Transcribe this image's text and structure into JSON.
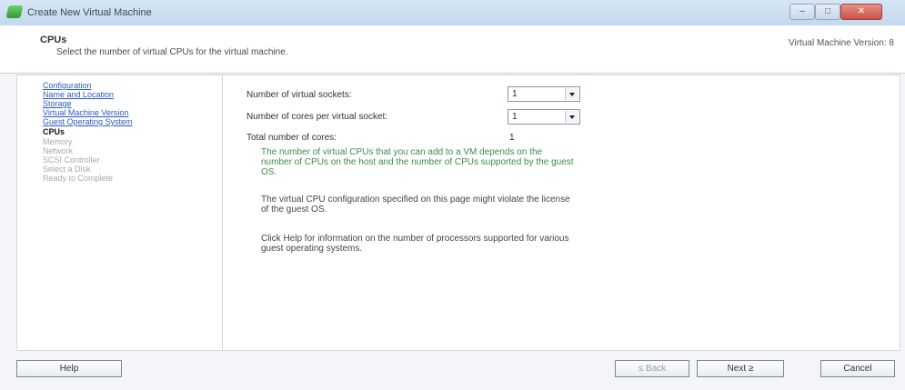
{
  "window": {
    "title": "Create New Virtual Machine",
    "controls": {
      "minimize": "–",
      "maximize": "□",
      "close": "✕"
    }
  },
  "header": {
    "title": "CPUs",
    "subtitle": "Select the number of virtual CPUs for the virtual machine.",
    "version": "Virtual Machine Version: 8"
  },
  "nav": {
    "items": [
      {
        "label": "Configuration",
        "state": "done"
      },
      {
        "label": "Name and Location",
        "state": "done"
      },
      {
        "label": "Storage",
        "state": "done"
      },
      {
        "label": "Virtual Machine Version",
        "state": "done"
      },
      {
        "label": "Guest Operating System",
        "state": "done"
      },
      {
        "label": "CPUs",
        "state": "current"
      },
      {
        "label": "Memory",
        "state": "todo"
      },
      {
        "label": "Network",
        "state": "todo"
      },
      {
        "label": "SCSI Controller",
        "state": "todo"
      },
      {
        "label": "Select a Disk",
        "state": "todo"
      },
      {
        "label": "Ready to Complete",
        "state": "todo"
      }
    ]
  },
  "form": {
    "sockets_label": "Number of virtual sockets:",
    "sockets_value": "1",
    "cores_label": "Number of cores per virtual socket:",
    "cores_value": "1",
    "total_label": "Total number of cores:",
    "total_value": "1",
    "info1": "The number of virtual CPUs that you can add to a VM depends on the number of CPUs on the host and the number of CPUs supported by the guest OS.",
    "info2": "The virtual CPU configuration specified on this page might violate the license of the guest OS.",
    "info3": "Click Help for information on the number of processors supported for various guest operating systems."
  },
  "buttons": {
    "help": "Help",
    "back": "≤ Back",
    "next": "Next ≥",
    "cancel": "Cancel"
  }
}
